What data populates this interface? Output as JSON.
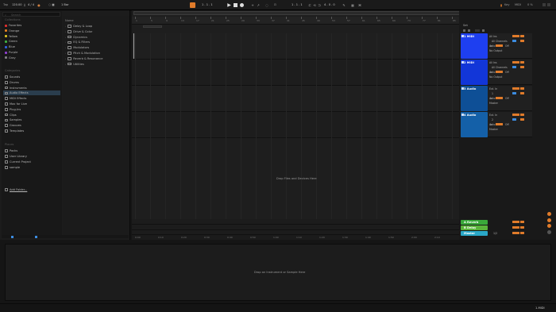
{
  "transport": {
    "tap": "Tap",
    "tempo": "120.00",
    "time_sig": "4 / 4",
    "quantize": "1 Bar",
    "position": "1 . 1 . 1",
    "loop_start": "1 . 1 . 1",
    "loop_length": "4 . 0 . 0",
    "key": "Key",
    "midi": "MIDI",
    "cpu": "0 %"
  },
  "browser": {
    "search_placeholder": "Search",
    "collections_title": "Collections",
    "collections": [
      {
        "label": "Favorites",
        "color": "#e03030"
      },
      {
        "label": "Orange",
        "color": "#e08020"
      },
      {
        "label": "Yellow",
        "color": "#d8c020"
      },
      {
        "label": "Green",
        "color": "#40b040"
      },
      {
        "label": "Blue",
        "color": "#3060e0"
      },
      {
        "label": "Purple",
        "color": "#9040d0"
      },
      {
        "label": "Gray",
        "color": "#808080"
      }
    ],
    "categories_title": "Categories",
    "categories": [
      {
        "label": "Sounds",
        "icon": "sounds-icon"
      },
      {
        "label": "Drums",
        "icon": "drums-icon"
      },
      {
        "label": "Instruments",
        "icon": "instruments-icon"
      },
      {
        "label": "Audio Effects",
        "icon": "audio-effects-icon"
      },
      {
        "label": "MIDI Effects",
        "icon": "midi-effects-icon"
      },
      {
        "label": "Max for Live",
        "icon": "max-icon"
      },
      {
        "label": "Plug-Ins",
        "icon": "plugin-icon"
      },
      {
        "label": "Clips",
        "icon": "clips-icon"
      },
      {
        "label": "Samples",
        "icon": "samples-icon"
      },
      {
        "label": "Grooves",
        "icon": "grooves-icon"
      },
      {
        "label": "Templates",
        "icon": "templates-icon"
      }
    ],
    "places_title": "Places",
    "places": [
      {
        "label": "Packs"
      },
      {
        "label": "User Library"
      },
      {
        "label": "Current Project"
      },
      {
        "label": "sample"
      },
      {
        "label": "Add Folder..."
      }
    ],
    "name_header": "Name",
    "files": [
      "Delay & Loop",
      "Drive & Color",
      "Dynamics",
      "EQ & Filters",
      "Modulators",
      "Pitch & Modulation",
      "Reverb & Resonance",
      "Utilities"
    ]
  },
  "arrangement": {
    "drop_hint": "Drop Files and Devices Here",
    "bars": [
      "1",
      "5",
      "9",
      "13",
      "17",
      "21",
      "25",
      "29",
      "33",
      "37",
      "41",
      "45",
      "49",
      "53",
      "57",
      "61",
      "65",
      "69",
      "73",
      "77",
      "81",
      "85"
    ],
    "times": [
      "0:00",
      "0:10",
      "0:20",
      "0:30",
      "0:40",
      "0:50",
      "1:00",
      "1:10",
      "1:20",
      "1:30",
      "1:40",
      "1:50",
      "2:00",
      "2:10"
    ]
  },
  "mixer": {
    "set_label": "Set",
    "tracks": [
      {
        "name": "1 MIDI",
        "color": "#1e3ff0",
        "input": "All Ins",
        "channel": "All Channels",
        "monitor": "In",
        "auto": "Auto",
        "off": "Off",
        "output": "No Output"
      },
      {
        "name": "2 MIDI",
        "color": "#1236d8",
        "input": "All Ins",
        "channel": "All Channels",
        "monitor": "In",
        "auto": "Auto",
        "off": "Off",
        "output": "No Output"
      },
      {
        "name": "3 Audio",
        "color": "#0e4f96",
        "input": "Ext. In",
        "channel": "1",
        "monitor": "In",
        "auto": "Auto",
        "off": "Off",
        "output": "Master"
      },
      {
        "name": "4 Audio",
        "color": "#1460a8",
        "input": "Ext. In",
        "channel": "2",
        "monitor": "In",
        "auto": "Auto",
        "off": "Off",
        "output": "Master"
      }
    ],
    "returns": [
      {
        "name": "A Reverb",
        "color": "#3aa83a"
      },
      {
        "name": "B Delay",
        "color": "#5ab33a"
      },
      {
        "name": "Master",
        "color": "#2aa8c8"
      }
    ],
    "master_value": "1/2"
  },
  "detail": {
    "drop_hint": "Drop an Instrument or Sample Here"
  },
  "status": {
    "track_name": "1-MIDI"
  }
}
